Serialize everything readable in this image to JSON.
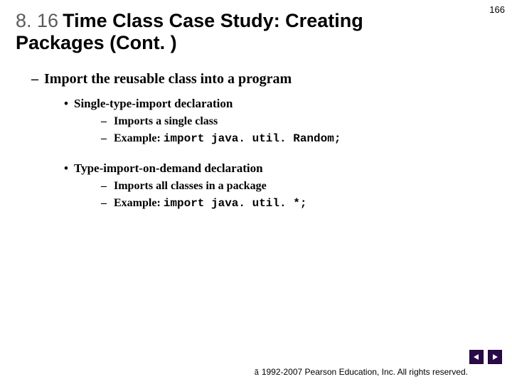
{
  "page_number": "166",
  "title": {
    "section": "8. 16",
    "text": "Time Class Case Study: Creating Packages (Cont. )"
  },
  "body": {
    "level1": "Import the reusable class into a program",
    "items": [
      {
        "heading": "Single-type-import declaration",
        "sub": [
          "Imports a single class",
          {
            "prefix": "Example: ",
            "code": "import java. util. Random;"
          }
        ]
      },
      {
        "heading": "Type-import-on-demand declaration",
        "sub": [
          "Imports all classes in a package",
          {
            "prefix": "Example: ",
            "code": "import java. util. *;"
          }
        ]
      }
    ]
  },
  "footer": {
    "symbol": "ã",
    "text": "1992-2007 Pearson Education, Inc. All rights reserved."
  }
}
